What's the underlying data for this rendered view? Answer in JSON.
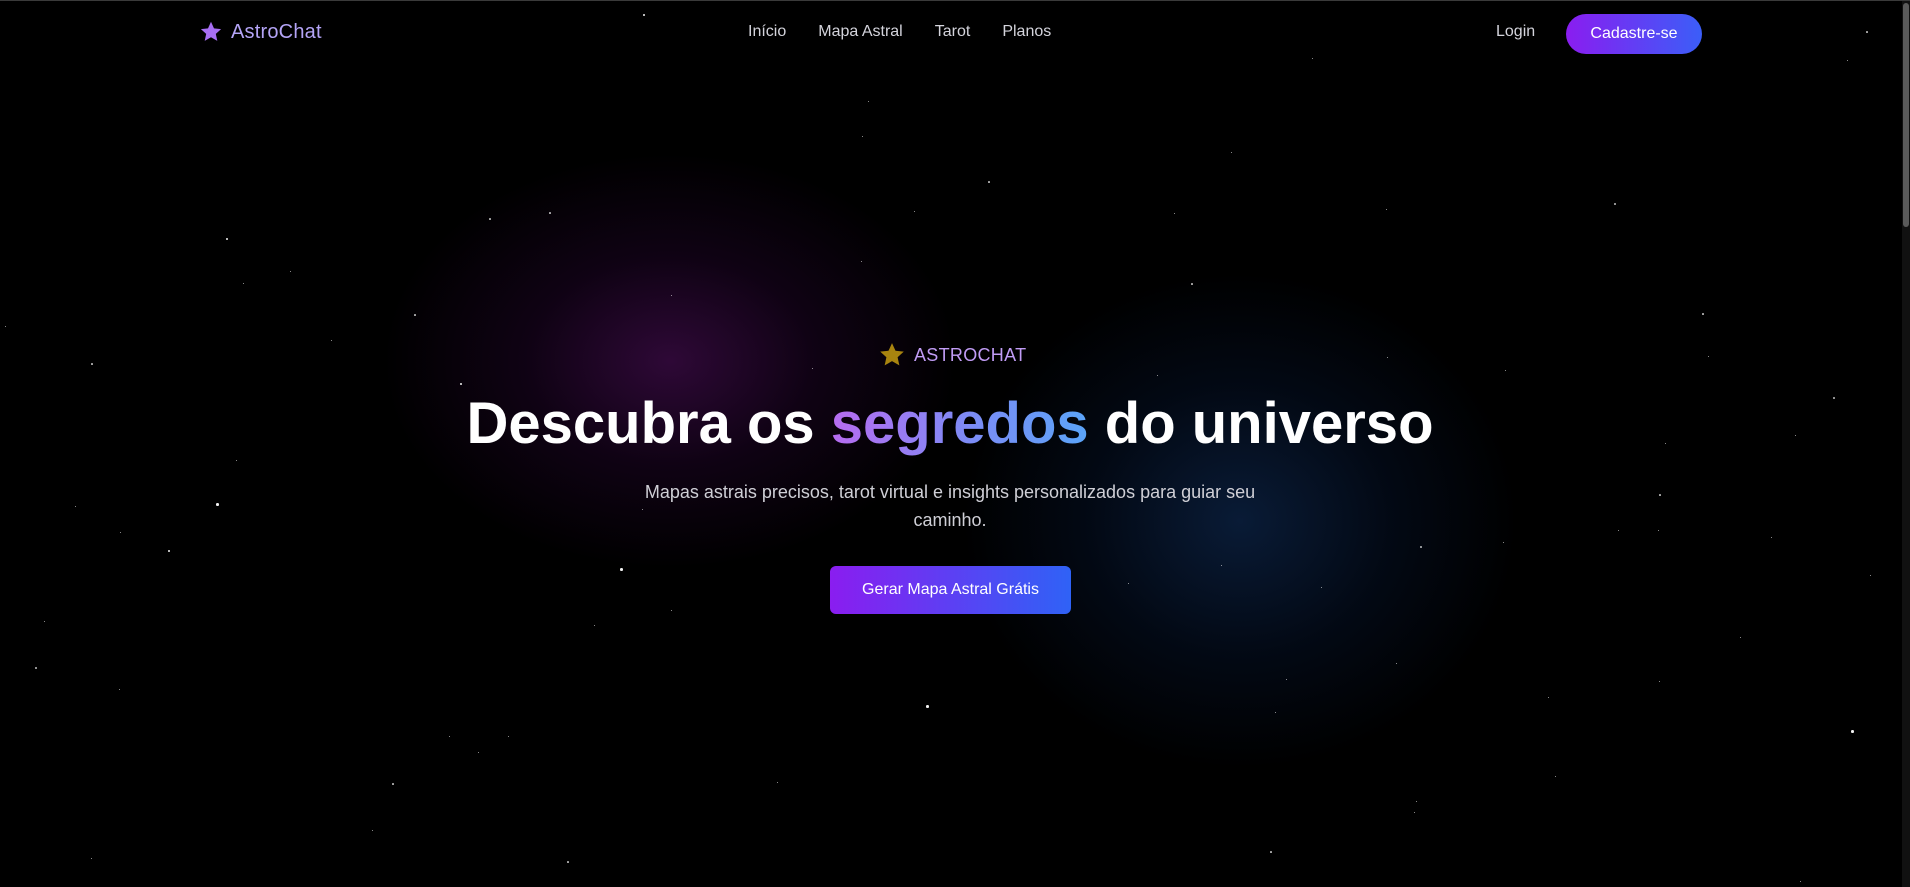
{
  "brand": {
    "name": "AstroChat",
    "icon": "star-icon",
    "icon_color": "#a76ef3"
  },
  "nav": {
    "links": [
      "Início",
      "Mapa Astral",
      "Tarot",
      "Planos"
    ],
    "login_label": "Login",
    "signup_label": "Cadastre-se"
  },
  "hero": {
    "badge_icon": "star-icon",
    "badge_icon_color": "#a8840f",
    "badge_text": "ASTROCHAT",
    "headline_before": "Descubra os",
    "headline_highlight": "segredos",
    "headline_after": "do universo",
    "subtitle": "Mapas astrais precisos, tarot virtual e insights personalizados para guiar seu caminho.",
    "cta_label": "Gerar Mapa Astral Grátis"
  },
  "colors": {
    "background": "#000000",
    "accent_purple": "#8a1df0",
    "accent_blue": "#3b5ef8",
    "brand_text": "#b4a4f6",
    "badge_text": "#c19cf5"
  }
}
